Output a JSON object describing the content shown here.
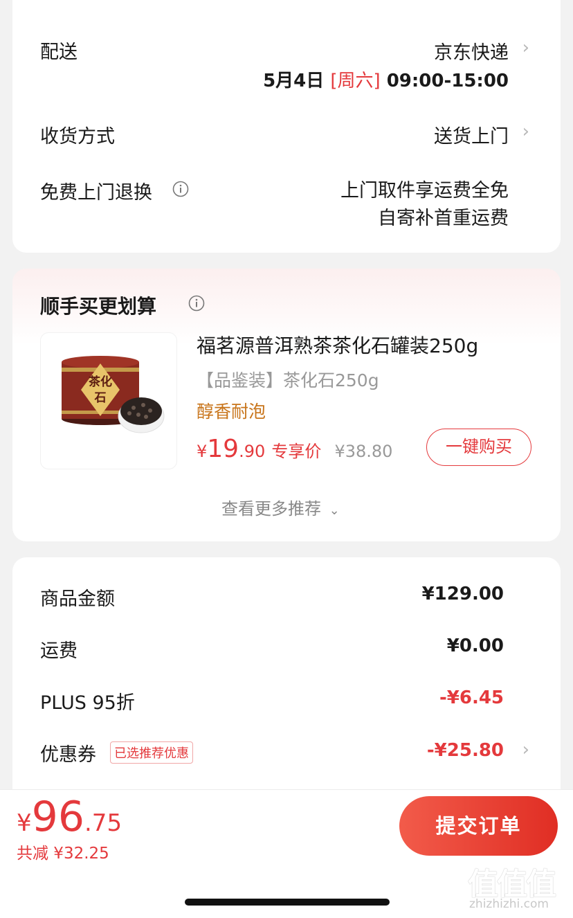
{
  "delivery": {
    "shipping_label": "配送",
    "carrier": "京东快递",
    "date": "5月4日",
    "weekday": "[周六]",
    "time_window": "09:00-15:00",
    "receive_method_label": "收货方式",
    "receive_method_value": "送货上门",
    "free_return_label": "免费上门退换",
    "free_return_line1": "上门取件享运费全免",
    "free_return_line2": "自寄补首重运费"
  },
  "recommend": {
    "title": "顺手买更划算",
    "product_name": "福茗源普洱熟茶茶化石罐装250g",
    "product_spec": "【品鉴装】茶化石250g",
    "product_tag": "醇香耐泡",
    "currency": "¥",
    "price_int": "19",
    "price_dec": ".90",
    "price_label": "专享价",
    "original_price": "¥38.80",
    "buy_button": "一键购买",
    "more_link": "查看更多推荐",
    "image_text": "茶化石"
  },
  "summary": {
    "goods_label": "商品金额",
    "goods_value": "¥129.00",
    "freight_label": "运费",
    "freight_value": "¥0.00",
    "plus_label": "PLUS 95折",
    "plus_value": "-¥6.45",
    "coupon_label": "优惠券",
    "coupon_badge": "已选推荐优惠",
    "coupon_value": "-¥25.80"
  },
  "bottom": {
    "currency": "¥",
    "total_int": "96",
    "total_dec": ".75",
    "saved_text": "共减 ¥32.25",
    "submit_label": "提交订单"
  },
  "watermark": {
    "big": "值值值",
    "small": "zhizhizhi.com"
  },
  "colors": {
    "accent_red": "#e4393c",
    "price_orange": "#c8741a",
    "background": "#f2f2f2"
  }
}
